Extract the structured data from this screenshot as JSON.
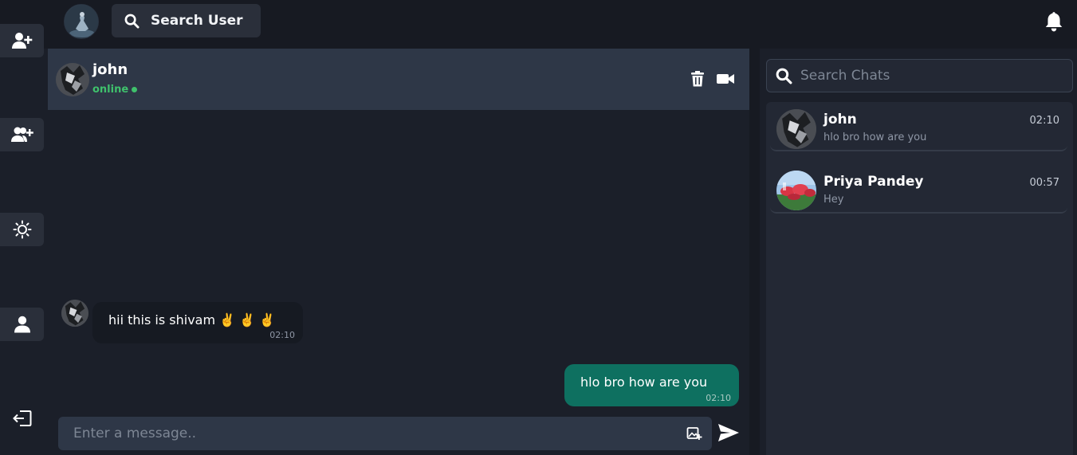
{
  "topbar": {
    "search_user_label": "Search User"
  },
  "chat": {
    "contact_name": "john",
    "status": "online",
    "messages": [
      {
        "direction": "in",
        "text": "hii this is shivam ✌️ ✌️ ✌️",
        "time": "02:10"
      },
      {
        "direction": "out",
        "text": "hlo bro how are you",
        "time": "02:10"
      }
    ],
    "composer_placeholder": "Enter a message.."
  },
  "sidebar": {
    "search_placeholder": "Search Chats",
    "chats": [
      {
        "name": "john",
        "last_message": "hlo bro how are you",
        "time": "02:10"
      },
      {
        "name": "Priya Pandey",
        "last_message": "Hey",
        "time": "00:57"
      }
    ]
  },
  "colors": {
    "background": "#1b1f29",
    "header": "#2e3747",
    "outgoing_bubble": "#0e7060",
    "incoming_bubble": "#161a22",
    "online": "#3fc16c"
  },
  "icons": [
    "user-plus-icon",
    "users-plus-icon",
    "sun-icon",
    "user-icon",
    "logout-icon",
    "search-icon",
    "bell-icon",
    "trash-icon",
    "video-icon",
    "image-add-icon",
    "send-icon"
  ]
}
